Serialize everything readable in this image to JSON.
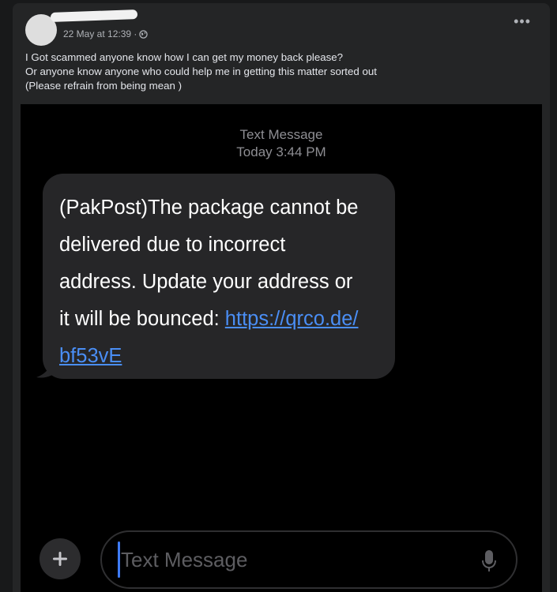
{
  "post": {
    "author_redacted": true,
    "timestamp": "22 May at 12:39 ·",
    "privacy_icon": "globe-icon",
    "more_icon": "more-options-icon",
    "more_label": "•••",
    "text_lines": [
      "I Got scammed anyone know how I can get my money back please?",
      "Or anyone know anyone who could help me in getting this matter sorted out",
      "(Please refrain from being mean )"
    ]
  },
  "message": {
    "header_title": "Text Message",
    "header_time": "Today 3:44 PM",
    "body_lines": [
      "(PakPost)The package cannot be",
      "delivered due to incorrect",
      "address. Update your address or",
      "it will be bounced: "
    ],
    "link_part1": "https://qrco.de/",
    "link_part2": "bf53vE"
  },
  "compose": {
    "placeholder": "Text Message",
    "plus_icon": "plus-icon",
    "mic_icon": "microphone-icon"
  },
  "colors": {
    "page_bg": "#18191a",
    "post_bg": "#242526",
    "bubble_bg": "#262628",
    "link": "#4a8ef5",
    "cursor": "#3e7bf5"
  }
}
